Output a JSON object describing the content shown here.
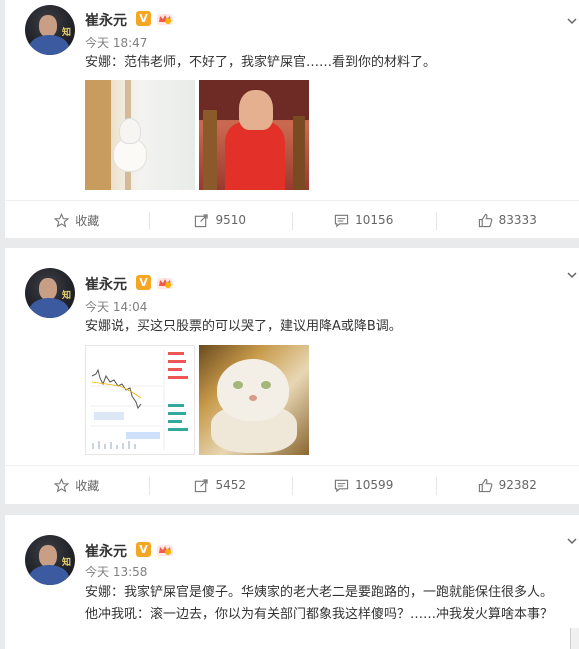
{
  "posts": [
    {
      "author": "崔永元",
      "vip_badge": "V",
      "time": "今天 18:47",
      "text": "安娜：范伟老师，不好了，我家铲屎官……看到你的材料了。",
      "images": [
        "cat-photo",
        "kungfu-photo"
      ],
      "actions": {
        "favorite": "收藏",
        "repost": "9510",
        "comment": "10156",
        "like": "83333"
      }
    },
    {
      "author": "崔永元",
      "vip_badge": "V",
      "time": "今天 14:04",
      "text": "安娜说，买这只股票的可以哭了，建议用降A或降B调。",
      "images": [
        "stock-chart",
        "cat-painting"
      ],
      "actions": {
        "favorite": "收藏",
        "repost": "5452",
        "comment": "10599",
        "like": "92382"
      }
    },
    {
      "author": "崔永元",
      "vip_badge": "V",
      "time": "今天 13:58",
      "text": "安娜：我家铲屎官是傻子。华姨家的老大老二是要跑路的，一跑就能保住很多人。他冲我吼：滚一边去，你以为有关部门都象我这样傻吗？……冲我发火算啥本事？"
    }
  ],
  "avatar_mark": "知",
  "colors": {
    "background": "#e9eaec",
    "badge": "#f5a623",
    "meta": "#808080"
  },
  "icons": [
    "star-icon",
    "repost-icon",
    "comment-icon",
    "thumbs-up-icon",
    "chevron-down-icon",
    "crown-icon"
  ]
}
